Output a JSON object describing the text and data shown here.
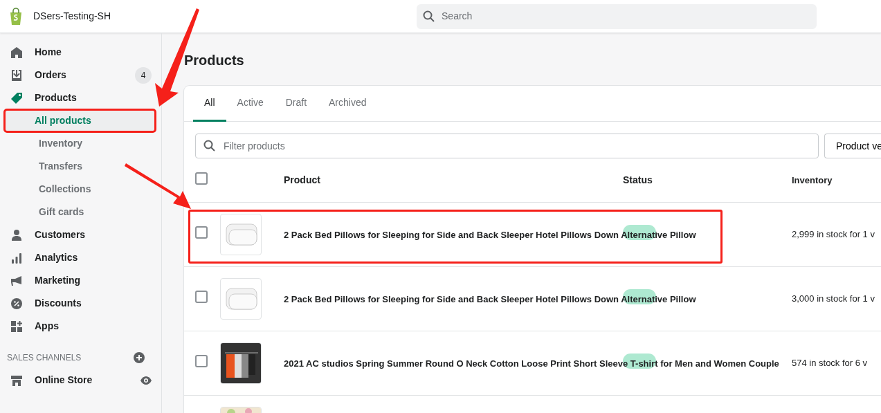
{
  "top_bar": {
    "store_name": "DSers-Testing-SH",
    "search": {
      "placeholder": "Search"
    }
  },
  "sidebar": {
    "items": [
      {
        "label": "Home"
      },
      {
        "label": "Orders",
        "count": "4"
      },
      {
        "label": "Products",
        "children": [
          {
            "label": "All products",
            "selected": true,
            "highlighted": true
          },
          {
            "label": "Inventory",
            "selected": false,
            "highlighted": false
          },
          {
            "label": "Transfers",
            "selected": false,
            "highlighted": false
          },
          {
            "label": "Collections",
            "selected": false,
            "highlighted": false
          },
          {
            "label": "Gift cards",
            "selected": false,
            "highlighted": false
          }
        ]
      },
      {
        "label": "Customers"
      },
      {
        "label": "Analytics"
      },
      {
        "label": "Marketing"
      },
      {
        "label": "Discounts"
      },
      {
        "label": "Apps"
      }
    ],
    "section": {
      "title": "SALES CHANNELS",
      "items": [
        {
          "label": "Online Store"
        }
      ]
    }
  },
  "page": {
    "title": "Products",
    "tabs": [
      {
        "label": "All",
        "selected": true
      },
      {
        "label": "Active",
        "selected": false
      },
      {
        "label": "Draft",
        "selected": false
      },
      {
        "label": "Archived",
        "selected": false
      }
    ],
    "filter": {
      "placeholder": "Filter products"
    },
    "vendor_button": "Product ve",
    "table": {
      "select_all_checked": false,
      "columns": [
        "Product",
        "Status",
        "Inventory"
      ],
      "rows": [
        {
          "title": "2 Pack Bed Pillows for Sleeping for Side and Back Sleeper Hotel Pillows Down Alternative Pillow",
          "inventory": "2,999 in stock for 1 v",
          "checked": false,
          "highlighted": true
        },
        {
          "title": "2 Pack Bed Pillows for Sleeping for Side and Back Sleeper Hotel Pillows Down Alternative Pillow",
          "inventory": "3,000 in stock for 1 v",
          "checked": false,
          "highlighted": false
        },
        {
          "title": "2021 AC studios Spring Summer Round O Neck Cotton Loose Print Short Sleeve T-shirt for Men and Women Couple",
          "inventory": "574 in stock for 6 v",
          "checked": false,
          "highlighted": false
        },
        {}
      ]
    }
  }
}
